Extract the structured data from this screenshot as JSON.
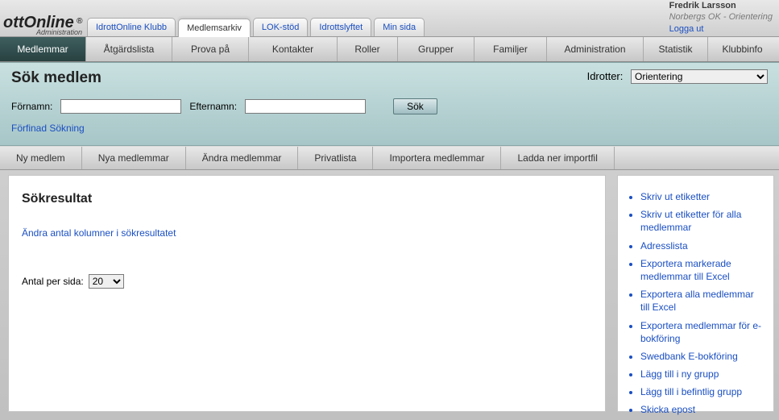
{
  "header": {
    "logo_main": "ottOnline",
    "logo_sub": "Administration",
    "tabs": [
      {
        "label": "IdrottOnline Klubb",
        "active": false
      },
      {
        "label": "Medlemsarkiv",
        "active": true
      },
      {
        "label": "LOK-stöd",
        "active": false
      },
      {
        "label": "Idrottslyftet",
        "active": false
      },
      {
        "label": "Min sida",
        "active": false
      }
    ],
    "user": {
      "name": "Fredrik Larsson",
      "club": "Norbergs OK - Orientering",
      "logout": "Logga ut"
    }
  },
  "main_nav": [
    "Medlemmar",
    "Åtgärdslista",
    "Prova på",
    "Kontakter",
    "Roller",
    "Grupper",
    "Familjer",
    "Administration",
    "Statistik",
    "Klubbinfo"
  ],
  "search_panel": {
    "title": "Sök medlem",
    "idrotter_label": "Idrotter:",
    "idrotter_value": "Orientering",
    "firstname_label": "Förnamn:",
    "lastname_label": "Efternamn:",
    "firstname_value": "",
    "lastname_value": "",
    "sok_btn": "Sök",
    "refined": "Förfinad Sökning"
  },
  "sub_nav": [
    "Ny medlem",
    "Nya medlemmar",
    "Ändra medlemmar",
    "Privatlista",
    "Importera medlemmar",
    "Ladda ner importfil"
  ],
  "results": {
    "title": "Sökresultat",
    "change_columns": "Ändra antal kolumner i sökresultatet",
    "per_page_label": "Antal per sida:",
    "per_page_value": "20"
  },
  "side_links": [
    "Skriv ut etiketter",
    "Skriv ut etiketter för alla medlemmar",
    "Adresslista",
    "Exportera markerade medlemmar till Excel",
    "Exportera alla medlemmar till Excel",
    "Exportera medlemmar för e-bokföring",
    "Swedbank E-bokföring",
    "Lägg till i ny grupp",
    "Lägg till i befintlig grupp",
    "Skicka epost"
  ]
}
